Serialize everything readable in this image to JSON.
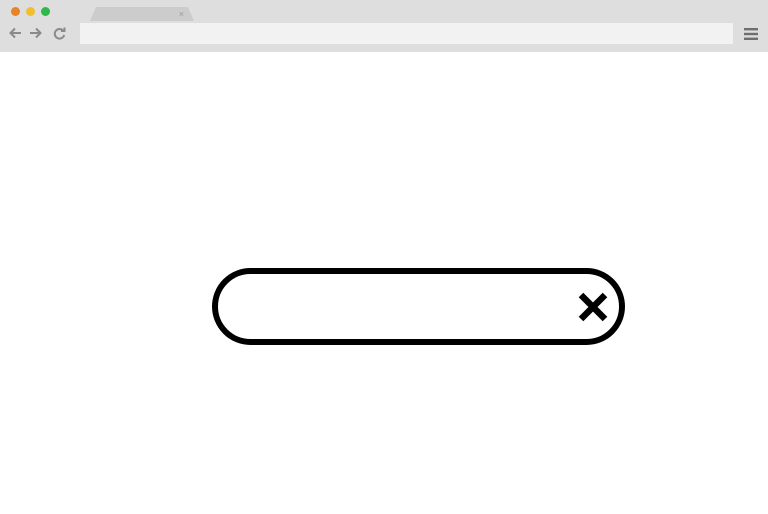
{
  "browser": {
    "window_controls": [
      {
        "name": "close",
        "color": "#e8832a"
      },
      {
        "name": "minimize",
        "color": "#f0be2e"
      },
      {
        "name": "maximize",
        "color": "#2eb84a"
      }
    ],
    "tab": {
      "title": "",
      "close_glyph": "×"
    },
    "address_bar": {
      "value": ""
    },
    "icons": {
      "back": "back-arrow-icon",
      "forward": "forward-arrow-icon",
      "reload": "reload-icon",
      "menu": "hamburger-menu-icon"
    },
    "chrome_color": "#dedede"
  },
  "search": {
    "value": "",
    "close_icon": "close-x-icon",
    "border_color": "#000000"
  }
}
